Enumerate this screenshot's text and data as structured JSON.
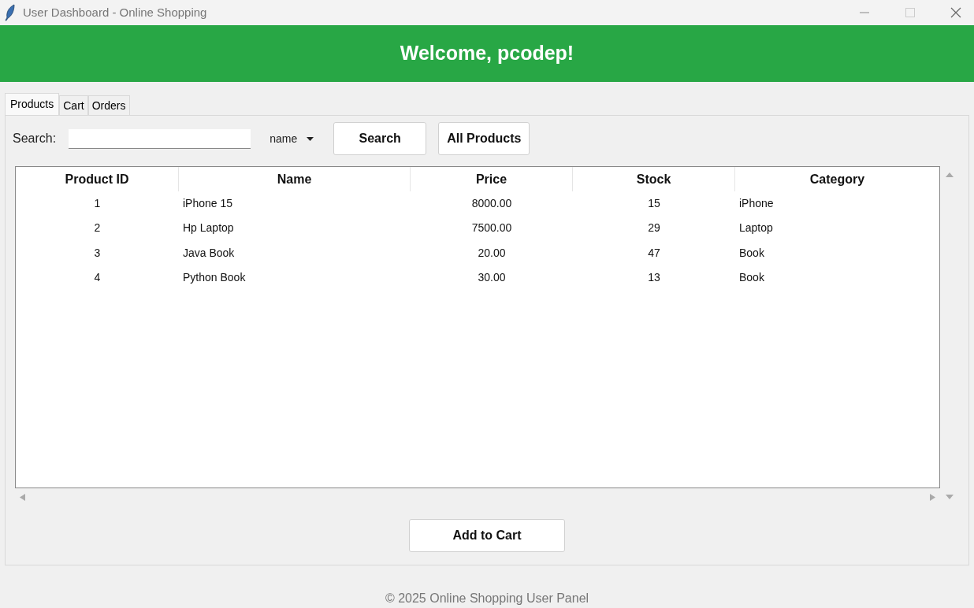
{
  "window": {
    "title": "User Dashboard - Online Shopping"
  },
  "banner": {
    "text": "Welcome, pcodep!"
  },
  "tabs": [
    {
      "label": "Products",
      "selected": true
    },
    {
      "label": "Cart",
      "selected": false
    },
    {
      "label": "Orders",
      "selected": false
    }
  ],
  "search": {
    "label": "Search:",
    "field": "name",
    "buttons": [
      "Search",
      "All Products"
    ]
  },
  "table": {
    "columns": [
      "Product ID",
      "Name",
      "Price",
      "Stock",
      "Category"
    ],
    "rows": [
      [
        "1",
        "iPhone 15",
        "8000.00",
        "15",
        "iPhone"
      ],
      [
        "2",
        "Hp Laptop",
        "7500.00",
        "29",
        "Laptop"
      ],
      [
        "3",
        "Java Book",
        "20.00",
        "47",
        "Book"
      ],
      [
        "4",
        "Python Book",
        "30.00",
        "13",
        "Book"
      ]
    ]
  },
  "action_button": "Add to Cart",
  "footer": "© 2025 Online Shopping User Panel"
}
